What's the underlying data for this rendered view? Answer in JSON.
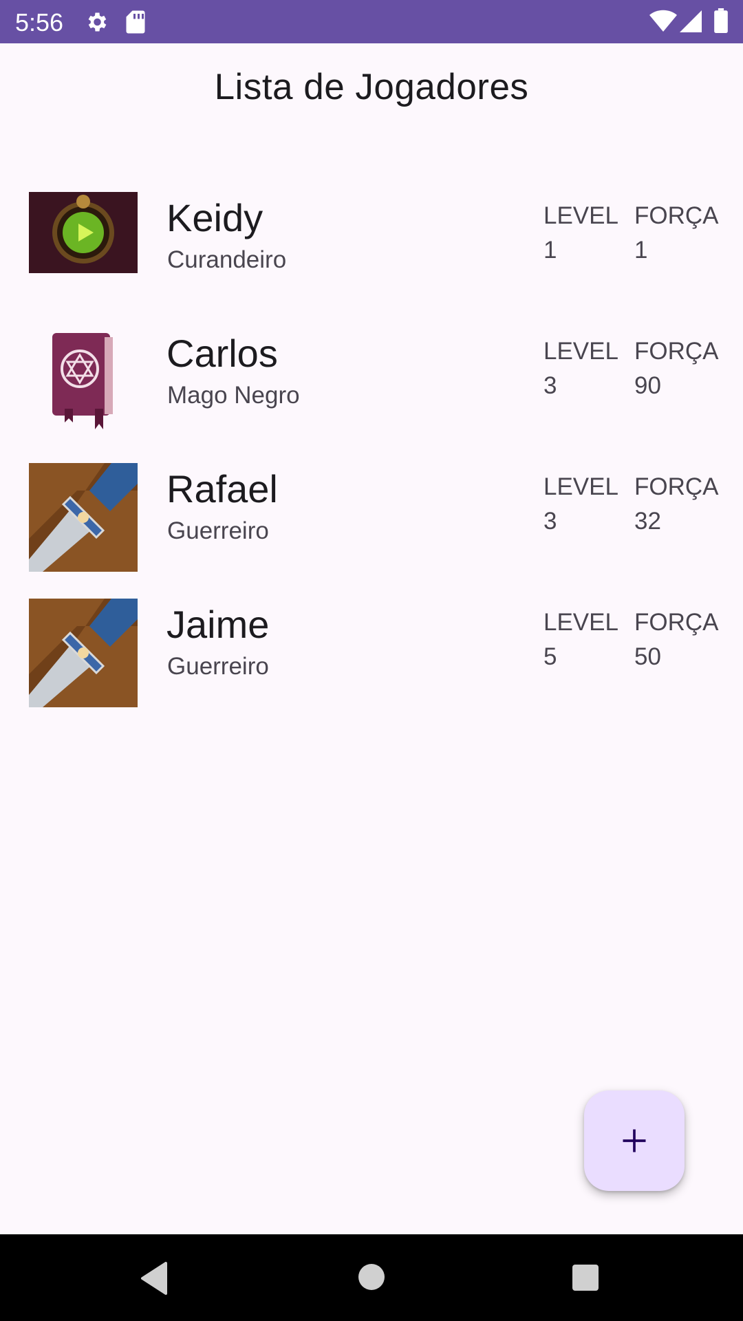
{
  "status_bar": {
    "time": "5:56",
    "icons": [
      "gear-icon",
      "sd-card-icon",
      "wifi-icon",
      "signal-icon",
      "battery-icon"
    ],
    "background": "#6750a4"
  },
  "title": "Lista de Jogadores",
  "players": [
    {
      "name": "Keidy",
      "class": "Curandeiro",
      "avatar": "healer-orb-image",
      "level_label": "LEVEL",
      "level": "1",
      "forca_label": "FORÇA",
      "forca": "1"
    },
    {
      "name": "Carlos",
      "class": "Mago Negro",
      "avatar": "spellbook-image",
      "level_label": "LEVEL",
      "level": "3",
      "forca_label": "FORÇA",
      "forca": "90"
    },
    {
      "name": "Rafael",
      "class": "Guerreiro",
      "avatar": "sword-image",
      "level_label": "LEVEL",
      "level": "3",
      "forca_label": "FORÇA",
      "forca": "32"
    },
    {
      "name": "Jaime",
      "class": "Guerreiro",
      "avatar": "sword-image",
      "level_label": "LEVEL",
      "level": "5",
      "forca_label": "FORÇA",
      "forca": "50"
    }
  ],
  "fab": {
    "icon": "plus-icon",
    "background": "#eaddff"
  },
  "nav_bar": {
    "icons": [
      "back-icon",
      "home-icon",
      "recents-icon"
    ]
  }
}
